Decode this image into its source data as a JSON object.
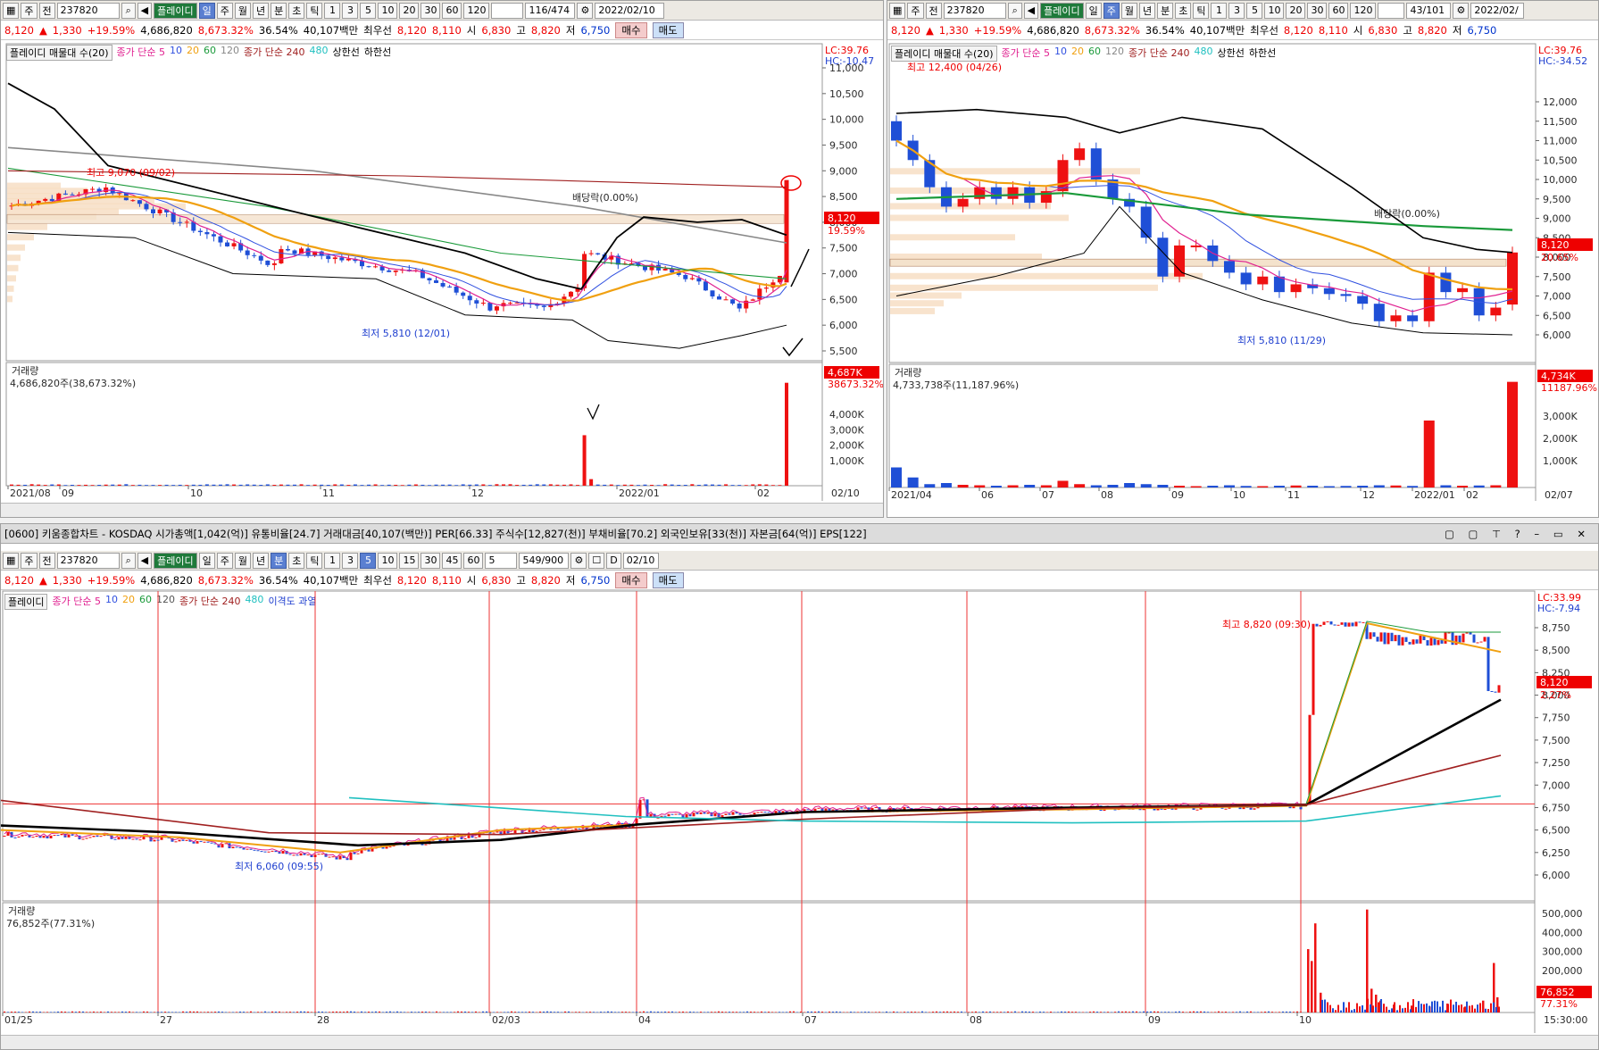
{
  "colors": {
    "up": "#ee1111",
    "down": "#1f4fd6",
    "ma5": "#e02090",
    "ma10": "#3050e0",
    "ma20": "#f0a010",
    "ma60": "#1a9a3a",
    "ma120": "#888888",
    "ma240": "#a02020",
    "ma480": "#20c0c0",
    "band": "#000000"
  },
  "left_chart": {
    "toolbar": {
      "mode": "주",
      "kind": "전",
      "code": "237820",
      "name": "플레이디",
      "periods": [
        "일",
        "주",
        "월",
        "년",
        "분",
        "초",
        "틱"
      ],
      "selected_period": "일",
      "nums": [
        "1",
        "3",
        "5",
        "10",
        "20",
        "30",
        "60",
        "120"
      ],
      "count": "116/474",
      "date": "2022/02/10"
    },
    "quote": {
      "price": "8,120",
      "change": "1,330",
      "rate": "+19.59%",
      "volume": "4,686,820",
      "vol_rate": "8,673.32%",
      "turnover": "36.54%",
      "amount": "40,107백만",
      "best": "최우선",
      "bid1": "8,120",
      "bid2": "8,110",
      "open_lbl": "시",
      "open": "6,830",
      "high_lbl": "고",
      "high": "8,820",
      "low_lbl": "저",
      "low": "6,750",
      "buy": "매수",
      "sell": "매도"
    },
    "legend": {
      "title": "플레이디 매물대 수(20)",
      "ma_lbl": "종가 단순 5",
      "m10": "10",
      "m20": "20",
      "m60": "60",
      "m120": "120",
      "ma240": "종가 단순 240",
      "m480": "480",
      "upper": "상한선",
      "lower": "하한선"
    },
    "lc": "LC:39.76",
    "hc": "HC:-10.47",
    "y_ticks": [
      "11,000",
      "10,500",
      "10,000",
      "9,500",
      "9,000",
      "8,500",
      "8,000",
      "7,500",
      "7,000",
      "6,500",
      "6,000",
      "5,500"
    ],
    "price_tag": "8,120",
    "price_tag2": "19.59%",
    "ann_high": "최고 9,070 (09/02)",
    "ann_low": "최저 5,810 (12/01)",
    "ann_div": "배당락(0.00%)",
    "vol_title": "거래량",
    "vol_value": "4,686,820주(38,673.32%)",
    "vol_ticks": [
      "4,000K",
      "3,000K",
      "2,000K",
      "1,000K"
    ],
    "vol_tag": "4,687K",
    "vol_tag2": "38673.32%",
    "x_ticks": [
      "2021/08",
      "09",
      "10",
      "11",
      "12",
      "2022/01",
      "02"
    ],
    "x_end": "02/10"
  },
  "right_chart": {
    "toolbar": {
      "mode": "주",
      "kind": "전",
      "code": "237820",
      "name": "플레이디",
      "periods": [
        "일",
        "주",
        "월",
        "년",
        "분",
        "초",
        "틱"
      ],
      "selected_period": "주",
      "nums": [
        "1",
        "3",
        "5",
        "10",
        "20",
        "30",
        "60",
        "120"
      ],
      "count": "43/101",
      "date": "2022/02/"
    },
    "quote": {
      "price": "8,120",
      "change": "1,330",
      "rate": "+19.59%",
      "volume": "4,686,820",
      "vol_rate": "8,673.32%",
      "turnover": "36.54%",
      "amount": "40,107백만",
      "best": "최우선",
      "bid1": "8,120",
      "bid2": "8,110",
      "open_lbl": "시",
      "open": "6,830",
      "high_lbl": "고",
      "high": "8,820",
      "low_lbl": "저",
      "low": "6,750"
    },
    "legend": {
      "title": "플레이디 매물대 수(20)",
      "ma_lbl": "종가 단순 5",
      "m10": "10",
      "m20": "20",
      "m60": "60",
      "m120": "120",
      "ma240": "종가 단순 240",
      "m480": "480",
      "upper": "상한선",
      "lower": "하한선"
    },
    "lc": "LC:39.76",
    "hc": "HC:-34.52",
    "y_ticks": [
      "12,000",
      "11,500",
      "11,000",
      "10,500",
      "10,000",
      "9,500",
      "9,000",
      "8,500",
      "8,000",
      "7,500",
      "7,000",
      "6,500",
      "6,000"
    ],
    "price_tag": "8,120",
    "price_tag2": "20.65%",
    "ann_high": "최고 12,400 (04/26)",
    "ann_low": "최저 5,810 (11/29)",
    "ann_div": "배당락(0.00%)",
    "vol_title": "거래량",
    "vol_value": "4,733,738주(11,187.96%)",
    "vol_ticks": [
      "3,000K",
      "2,000K",
      "1,000K"
    ],
    "vol_tag": "4,734K",
    "vol_tag2": "11187.96%",
    "x_ticks": [
      "2021/04",
      "06",
      "07",
      "08",
      "09",
      "10",
      "11",
      "12",
      "2022/01",
      "02"
    ],
    "x_end": "02/07"
  },
  "bottom_chart": {
    "title": "[0600] 키움종합차트 - KOSDAQ 시가총액[1,042(억)] 유통비율[24.7] 거래대금[40,107(백만)] PER[66.33] 주식수[12,827(천)] 부채비율[70.2] 외국인보유[33(천)] 자본금[64(억)] EPS[122]",
    "toolbar": {
      "mode": "주",
      "kind": "전",
      "code": "237820",
      "name": "플레이디",
      "periods": [
        "일",
        "주",
        "월",
        "년",
        "분",
        "초",
        "틱"
      ],
      "selected_period": "분",
      "nums": [
        "1",
        "3",
        "5",
        "10",
        "15",
        "30",
        "45",
        "60"
      ],
      "sel_num": "5",
      "interval": "5",
      "count": "549/900",
      "date": "02/10"
    },
    "quote": {
      "price": "8,120",
      "change": "1,330",
      "rate": "+19.59%",
      "volume": "4,686,820",
      "vol_rate": "8,673.32%",
      "turnover": "36.54%",
      "amount": "40,107백만",
      "best": "최우선",
      "bid1": "8,120",
      "bid2": "8,110",
      "open_lbl": "시",
      "open": "6,830",
      "high_lbl": "고",
      "high": "8,820",
      "low_lbl": "저",
      "low": "6,750",
      "buy": "매수",
      "sell": "매도"
    },
    "legend": {
      "title": "플레이디",
      "ma_lbl": "종가 단순 5",
      "m10": "10",
      "m20": "20",
      "m60": "60",
      "m120": "120",
      "ma240": "종가 단순 240",
      "m480": "480",
      "disp": "이격도 과열"
    },
    "lc": "LC:33.99",
    "hc": "HC:-7.94",
    "y_ticks": [
      "8,750",
      "8,500",
      "8,250",
      "8,000",
      "7,750",
      "7,500",
      "7,250",
      "7,000",
      "6,750",
      "6,500",
      "6,250",
      "6,000"
    ],
    "price_tag": "8,120",
    "price_tag2": "2.27%",
    "ann_high": "최고 8,820 (09:30)",
    "ann_low": "최저 6,060 (09:55)",
    "vol_title": "거래량",
    "vol_value": "76,852주(77.31%)",
    "vol_ticks": [
      "500,000",
      "400,000",
      "300,000",
      "200,000",
      "100,000"
    ],
    "vol_tag": "76,852",
    "vol_tag2": "77.31%",
    "x_ticks": [
      "01/25",
      "27",
      "28",
      "02/03",
      "04",
      "07",
      "08",
      "09",
      "10"
    ],
    "x_end": "15:30:00"
  }
}
